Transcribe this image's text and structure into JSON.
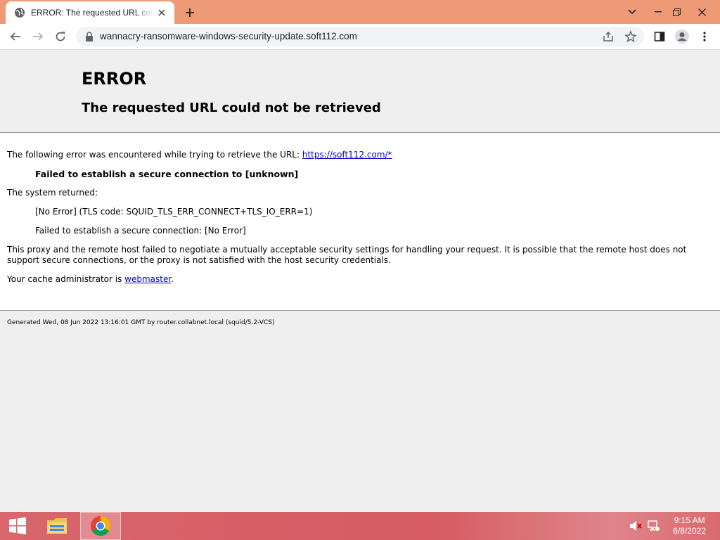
{
  "browser": {
    "tab_title": "ERROR: The requested URL could not be retrieved",
    "url": "wannacry-ransomware-windows-security-update.soft112.com"
  },
  "page": {
    "heading": "ERROR",
    "subheading": "The requested URL could not be retrieved",
    "intro_text": "The following error was encountered while trying to retrieve the URL: ",
    "intro_link": "https://soft112.com/*",
    "error_title": "Failed to establish a secure connection to [unknown]",
    "system_returned_label": "The system returned:",
    "system_detail_1": "[No Error] (TLS code: SQUID_TLS_ERR_CONNECT+TLS_IO_ERR=1)",
    "system_detail_2": "Failed to establish a secure connection: [No Error]",
    "explanation": "This proxy and the remote host failed to negotiate a mutually acceptable security settings for handling your request. It is possible that the remote host does not support secure connections, or the proxy is not satisfied with the host security credentials.",
    "admin_prefix": "Your cache administrator is ",
    "admin_link": "webmaster",
    "admin_suffix": ".",
    "footer": "Generated Wed, 08 Jun 2022 13:16:01 GMT by router.collabnet.local (squid/5.2-VCS)"
  },
  "taskbar": {
    "time": "9:15 AM",
    "date": "6/8/2022",
    "items": [
      "windows-start-icon",
      "file-explorer-icon",
      "chrome-icon"
    ]
  },
  "colors": {
    "titlebar": "#ef9a77",
    "taskbar": "#d65b63",
    "link": "#0000cc"
  }
}
